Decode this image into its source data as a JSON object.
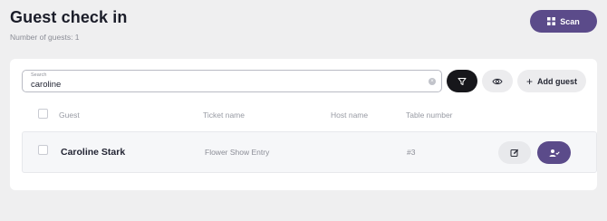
{
  "header": {
    "title": "Guest check in",
    "guest_count_text": "Number of guests: 1",
    "scan_label": "Scan"
  },
  "search": {
    "label": "Search",
    "value": "caroline"
  },
  "toolbar": {
    "add_guest_label": "Add guest"
  },
  "table": {
    "columns": [
      "Guest",
      "Ticket name",
      "Host name",
      "Table number"
    ],
    "rows": [
      {
        "guest": "Caroline Stark",
        "ticket": "Flower Show Entry",
        "host": "",
        "table_number": "#3"
      }
    ]
  },
  "colors": {
    "accent": "#5b4b8a",
    "filter_button": "#17171b",
    "background": "#efeff0"
  },
  "icons": [
    "qr-scan-icon",
    "clear-icon",
    "filter-icon",
    "eye-icon",
    "plus-icon",
    "edit-icon",
    "user-check-icon"
  ]
}
